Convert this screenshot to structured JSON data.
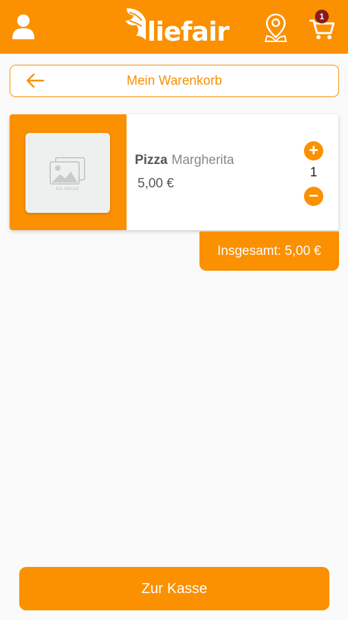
{
  "app": {
    "logo_text": "liefair",
    "cart_count": "1"
  },
  "header": {
    "title": "Mein Warenkorb"
  },
  "cart": {
    "items": [
      {
        "category": "Pizza",
        "name": "Margherita",
        "price": "5,00 €",
        "quantity": "1",
        "image_placeholder": "NO IMAGE"
      }
    ],
    "total": "Insgesamt: 5,00 €"
  },
  "actions": {
    "checkout_label": "Zur Kasse"
  },
  "colors": {
    "brand_orange": "#fb9000",
    "badge_red": "#8a1c1c",
    "background": "#fafafa"
  },
  "icons": {
    "user": "user-icon",
    "map": "map-pin-icon",
    "cart": "cart-icon",
    "back": "arrow-left-icon",
    "plus": "plus-icon",
    "minus": "minus-icon",
    "no_image": "image-placeholder-icon"
  }
}
